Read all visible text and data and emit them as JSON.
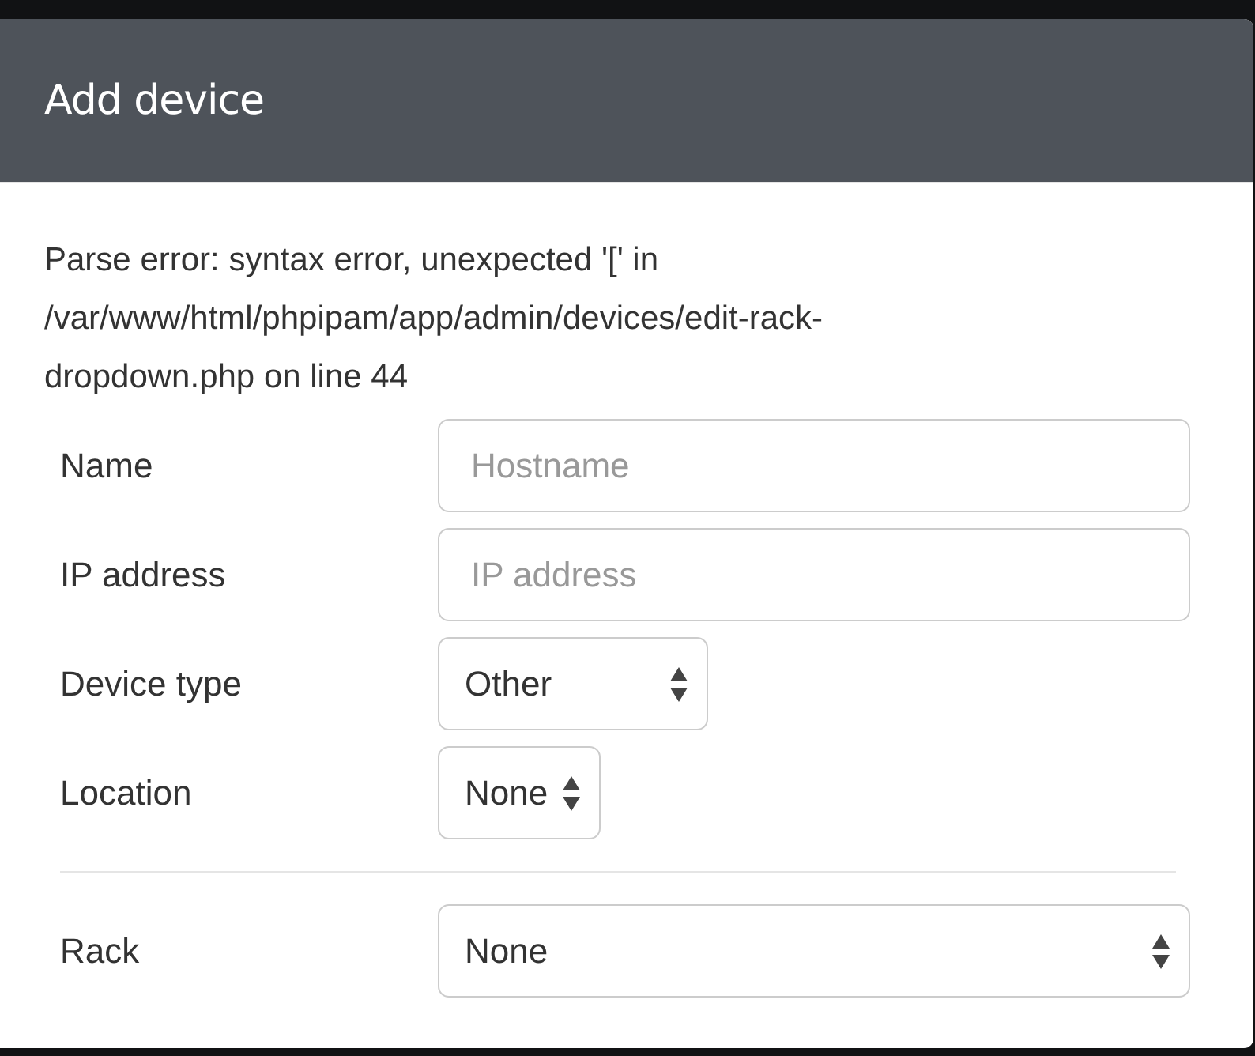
{
  "dialog": {
    "title": "Add device"
  },
  "error_message": "Parse error: syntax error, unexpected '[' in /var/www/html/phpipam/app/admin/devices/edit-rack-dropdown.php on line 44",
  "fields": [
    {
      "kind": "input",
      "label": "Name",
      "placeholder": "Hostname"
    },
    {
      "kind": "input",
      "label": "IP address",
      "placeholder": "IP address"
    },
    {
      "kind": "select",
      "label": "Device type",
      "value": "Other"
    },
    {
      "kind": "select",
      "label": "Location",
      "value": "None"
    },
    {
      "kind": "divider"
    },
    {
      "kind": "select",
      "label": "Rack",
      "value": "None"
    }
  ]
}
